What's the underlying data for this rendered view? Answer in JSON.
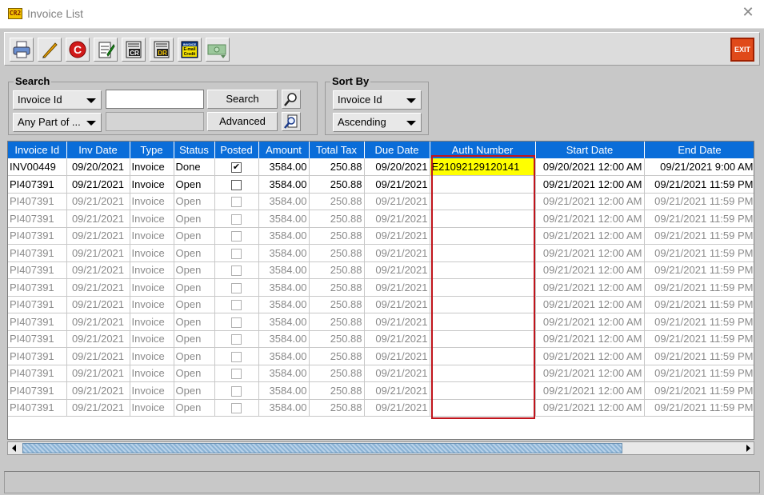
{
  "window": {
    "title": "Invoice List",
    "app_icon_text": "CR2"
  },
  "toolbar": {
    "buttons": [
      {
        "name": "print-icon"
      },
      {
        "name": "pencil-icon"
      },
      {
        "name": "currency-c-icon"
      },
      {
        "name": "notepad-icon"
      },
      {
        "name": "credit-doc-icon",
        "text": "CR"
      },
      {
        "name": "debit-doc-icon",
        "text": "DR"
      },
      {
        "name": "invoice-email-credit-icon",
        "text": "INVOICE E-mail Credit"
      },
      {
        "name": "money-transfer-icon"
      }
    ],
    "exit_label": "EXIT"
  },
  "search": {
    "label": "Search",
    "field_select": "Invoice Id",
    "match_select": "Any Part of ...",
    "input_value": "",
    "search_button": "Search",
    "advanced_button": "Advanced"
  },
  "sort": {
    "label": "Sort By",
    "field_select": "Invoice Id",
    "order_select": "Ascending"
  },
  "table": {
    "columns": [
      "Invoice Id",
      "Inv Date",
      "Type",
      "Status",
      "Posted",
      "Amount",
      "Total Tax",
      "Due Date",
      "Auth Number",
      "Start Date",
      "End Date"
    ],
    "rows": [
      {
        "id": "INV00449",
        "inv_date": "09/20/2021",
        "type": "Invoice",
        "status": "Done",
        "posted": true,
        "amount": "3584.00",
        "tax": "250.88",
        "due": "09/20/2021",
        "auth": "E21092129120141",
        "start": "09/20/2021 12:00 AM",
        "end": "09/21/2021 9:00 AM",
        "active": true
      },
      {
        "id": "PI407391",
        "inv_date": "09/21/2021",
        "type": "Invoice",
        "status": "Open",
        "posted": false,
        "amount": "3584.00",
        "tax": "250.88",
        "due": "09/21/2021",
        "auth": "",
        "start": "09/21/2021 12:00 AM",
        "end": "09/21/2021 11:59 PM",
        "active": true
      },
      {
        "id": "PI407391",
        "inv_date": "09/21/2021",
        "type": "Invoice",
        "status": "Open",
        "posted": false,
        "amount": "3584.00",
        "tax": "250.88",
        "due": "09/21/2021",
        "auth": "",
        "start": "09/21/2021 12:00 AM",
        "end": "09/21/2021 11:59 PM",
        "active": false
      },
      {
        "id": "PI407391",
        "inv_date": "09/21/2021",
        "type": "Invoice",
        "status": "Open",
        "posted": false,
        "amount": "3584.00",
        "tax": "250.88",
        "due": "09/21/2021",
        "auth": "",
        "start": "09/21/2021 12:00 AM",
        "end": "09/21/2021 11:59 PM",
        "active": false
      },
      {
        "id": "PI407391",
        "inv_date": "09/21/2021",
        "type": "Invoice",
        "status": "Open",
        "posted": false,
        "amount": "3584.00",
        "tax": "250.88",
        "due": "09/21/2021",
        "auth": "",
        "start": "09/21/2021 12:00 AM",
        "end": "09/21/2021 11:59 PM",
        "active": false
      },
      {
        "id": "PI407391",
        "inv_date": "09/21/2021",
        "type": "Invoice",
        "status": "Open",
        "posted": false,
        "amount": "3584.00",
        "tax": "250.88",
        "due": "09/21/2021",
        "auth": "",
        "start": "09/21/2021 12:00 AM",
        "end": "09/21/2021 11:59 PM",
        "active": false
      },
      {
        "id": "PI407391",
        "inv_date": "09/21/2021",
        "type": "Invoice",
        "status": "Open",
        "posted": false,
        "amount": "3584.00",
        "tax": "250.88",
        "due": "09/21/2021",
        "auth": "",
        "start": "09/21/2021 12:00 AM",
        "end": "09/21/2021 11:59 PM",
        "active": false
      },
      {
        "id": "PI407391",
        "inv_date": "09/21/2021",
        "type": "Invoice",
        "status": "Open",
        "posted": false,
        "amount": "3584.00",
        "tax": "250.88",
        "due": "09/21/2021",
        "auth": "",
        "start": "09/21/2021 12:00 AM",
        "end": "09/21/2021 11:59 PM",
        "active": false
      },
      {
        "id": "PI407391",
        "inv_date": "09/21/2021",
        "type": "Invoice",
        "status": "Open",
        "posted": false,
        "amount": "3584.00",
        "tax": "250.88",
        "due": "09/21/2021",
        "auth": "",
        "start": "09/21/2021 12:00 AM",
        "end": "09/21/2021 11:59 PM",
        "active": false
      },
      {
        "id": "PI407391",
        "inv_date": "09/21/2021",
        "type": "Invoice",
        "status": "Open",
        "posted": false,
        "amount": "3584.00",
        "tax": "250.88",
        "due": "09/21/2021",
        "auth": "",
        "start": "09/21/2021 12:00 AM",
        "end": "09/21/2021 11:59 PM",
        "active": false
      },
      {
        "id": "PI407391",
        "inv_date": "09/21/2021",
        "type": "Invoice",
        "status": "Open",
        "posted": false,
        "amount": "3584.00",
        "tax": "250.88",
        "due": "09/21/2021",
        "auth": "",
        "start": "09/21/2021 12:00 AM",
        "end": "09/21/2021 11:59 PM",
        "active": false
      },
      {
        "id": "PI407391",
        "inv_date": "09/21/2021",
        "type": "Invoice",
        "status": "Open",
        "posted": false,
        "amount": "3584.00",
        "tax": "250.88",
        "due": "09/21/2021",
        "auth": "",
        "start": "09/21/2021 12:00 AM",
        "end": "09/21/2021 11:59 PM",
        "active": false
      },
      {
        "id": "PI407391",
        "inv_date": "09/21/2021",
        "type": "Invoice",
        "status": "Open",
        "posted": false,
        "amount": "3584.00",
        "tax": "250.88",
        "due": "09/21/2021",
        "auth": "",
        "start": "09/21/2021 12:00 AM",
        "end": "09/21/2021 11:59 PM",
        "active": false
      },
      {
        "id": "PI407391",
        "inv_date": "09/21/2021",
        "type": "Invoice",
        "status": "Open",
        "posted": false,
        "amount": "3584.00",
        "tax": "250.88",
        "due": "09/21/2021",
        "auth": "",
        "start": "09/21/2021 12:00 AM",
        "end": "09/21/2021 11:59 PM",
        "active": false
      },
      {
        "id": "PI407391",
        "inv_date": "09/21/2021",
        "type": "Invoice",
        "status": "Open",
        "posted": false,
        "amount": "3584.00",
        "tax": "250.88",
        "due": "09/21/2021",
        "auth": "",
        "start": "09/21/2021 12:00 AM",
        "end": "09/21/2021 11:59 PM",
        "active": false
      }
    ]
  },
  "colors": {
    "header_bg": "#0a6dd9",
    "auth_highlight": "#ffff00",
    "annotation_box": "#c0141c"
  }
}
